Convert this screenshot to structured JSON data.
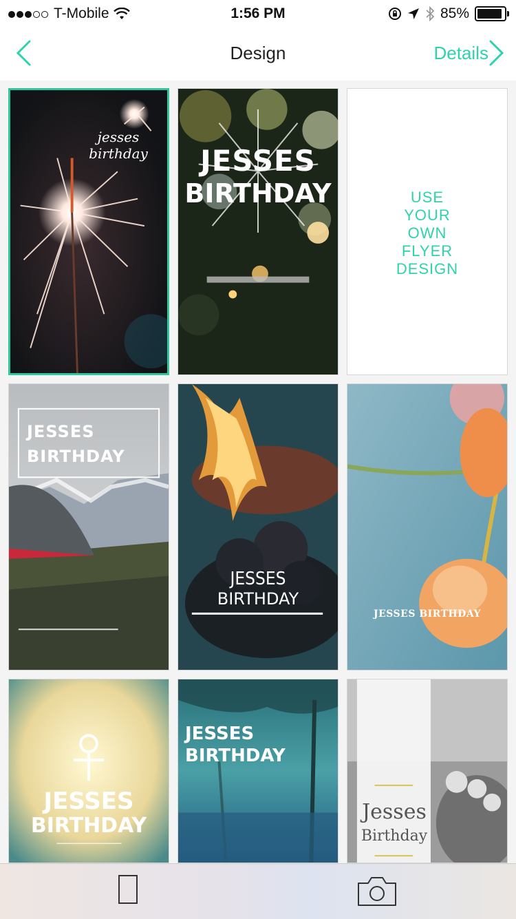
{
  "status_bar": {
    "carrier": "T-Mobile",
    "time": "1:56 PM",
    "battery": "85%"
  },
  "nav": {
    "title": "Design",
    "details_label": "Details"
  },
  "designs": [
    {
      "text": "jesses birthday"
    },
    {
      "line1": "JESSES",
      "line2": "BIRTHDAY"
    },
    {
      "lines": [
        "USE",
        "YOUR",
        "OWN",
        "FLYER",
        "DESIGN"
      ]
    },
    {
      "line1": "JESSES",
      "line2": "BIRTHDAY"
    },
    {
      "line1": "JESSES",
      "line2": "BIRTHDAY"
    },
    {
      "text": "JESSES BIRTHDAY"
    },
    {
      "line1": "JESSES",
      "line2": "BIRTHDAY"
    },
    {
      "line1": "JESSES",
      "line2": "BIRTHDAY"
    },
    {
      "line1": "Jesses",
      "line2": "Birthday"
    }
  ],
  "colors": {
    "accent": "#2ed3ad",
    "selected_border": "#2fc59d"
  }
}
